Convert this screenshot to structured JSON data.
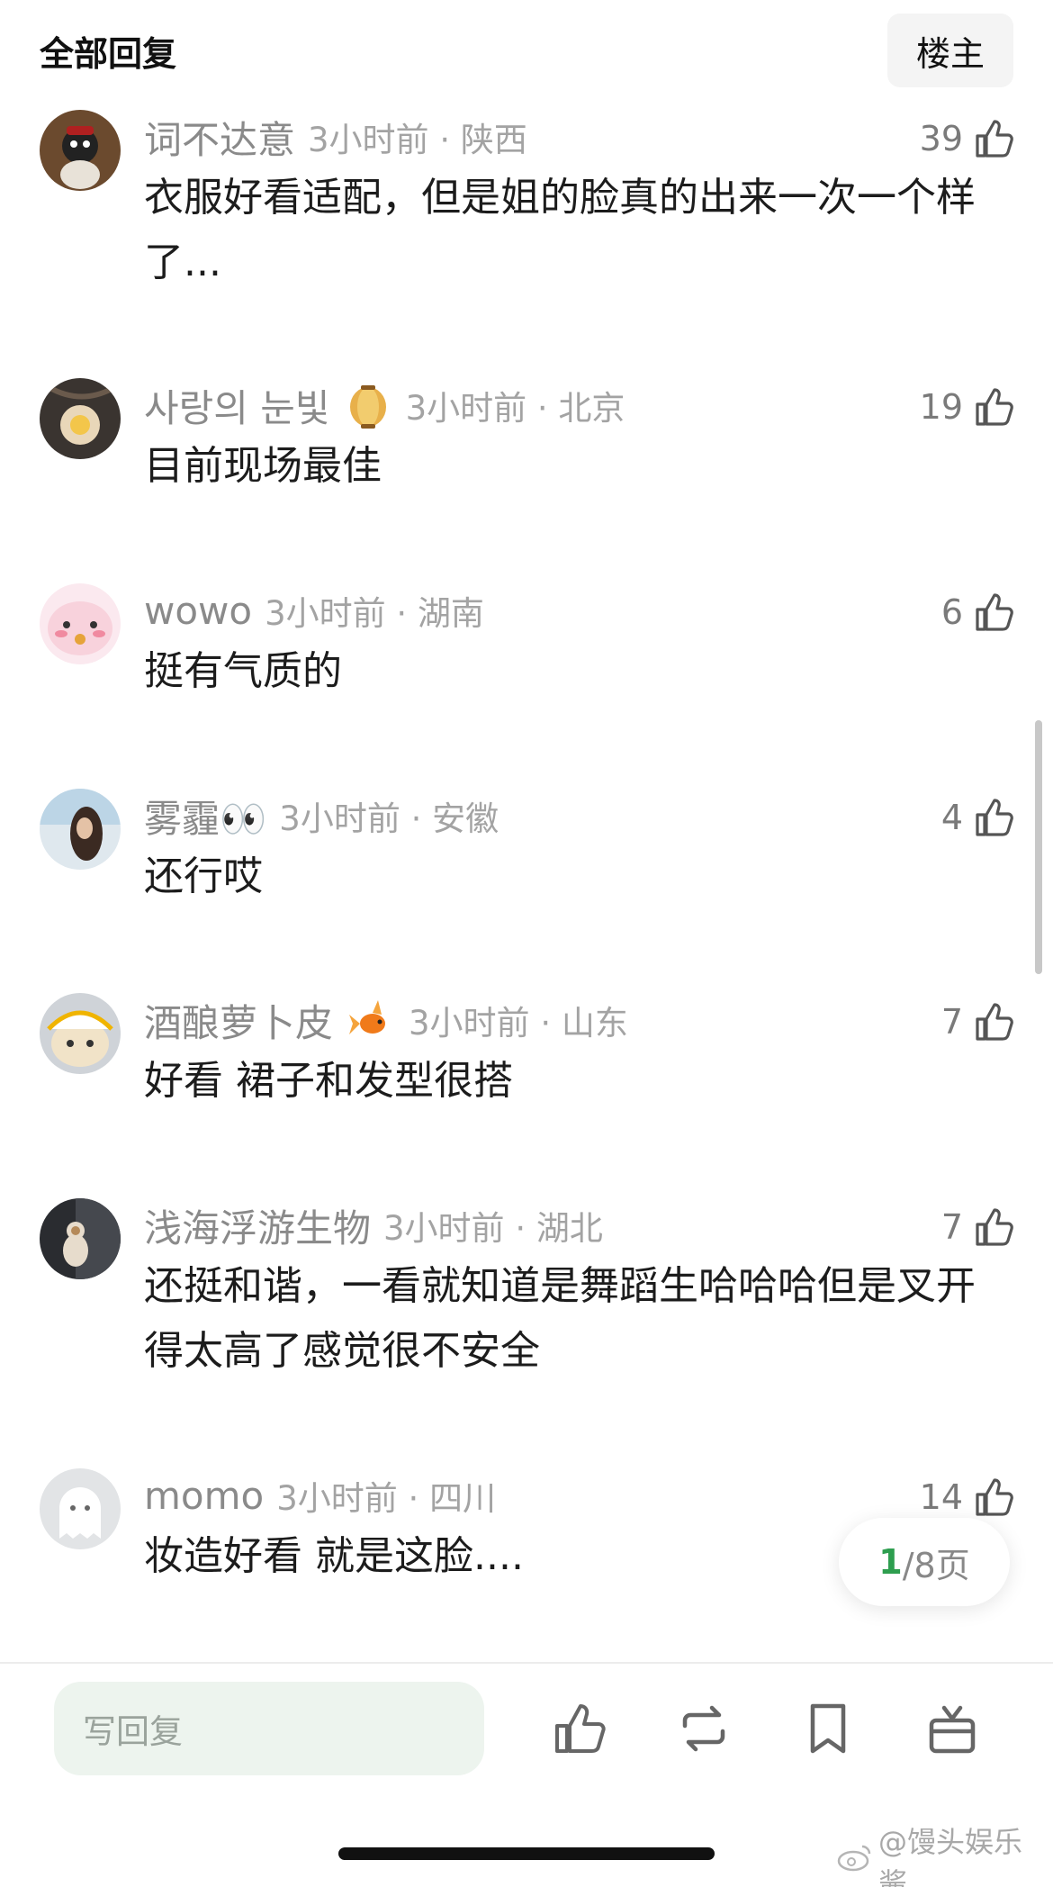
{
  "header": {
    "title": "全部回复",
    "owner_button": "楼主"
  },
  "comments": [
    {
      "username": "词不达意",
      "time": "3小时前",
      "location": "陕西",
      "likes": "39",
      "text": "衣服好看适配，但是姐的脸真的出来一次一个样了...",
      "avatar_icon": "cat-avatar-icon",
      "badge": null
    },
    {
      "username": "사랑의 눈빛",
      "time": "3小时前",
      "location": "北京",
      "likes": "19",
      "text": "目前现场最佳",
      "avatar_icon": "glowing-hand-avatar-icon",
      "badge": "lantern-badge-icon"
    },
    {
      "username": "wowo",
      "time": "3小时前",
      "location": "湖南",
      "likes": "6",
      "text": "挺有气质的",
      "avatar_icon": "pink-cartoon-avatar-icon",
      "badge": null
    },
    {
      "username": "雾霾👀",
      "time": "3小时前",
      "location": "安徽",
      "likes": "4",
      "text": "还行哎",
      "avatar_icon": "girl-photo-avatar-icon",
      "badge": null
    },
    {
      "username": "酒酿萝卜皮",
      "time": "3小时前",
      "location": "山东",
      "likes": "7",
      "text": "好看 裙子和发型很搭",
      "avatar_icon": "plush-hat-avatar-icon",
      "badge": "goldfish-badge-icon"
    },
    {
      "username": "浅海浮游生物",
      "time": "3小时前",
      "location": "湖北",
      "likes": "7",
      "text": "还挺和谐，一看就知道是舞蹈生哈哈哈但是叉开得太高了感觉很不安全",
      "avatar_icon": "cat-dark-avatar-icon",
      "badge": null
    },
    {
      "username": "momo",
      "time": "3小时前",
      "location": "四川",
      "likes": "14",
      "text": "妆造好看 就是这脸....",
      "avatar_icon": "ghost-avatar-icon",
      "badge": null
    }
  ],
  "pagination": {
    "current": "1",
    "total": "/8页"
  },
  "bottom_bar": {
    "reply_placeholder": "写回复",
    "actions": [
      "like-icon",
      "repost-icon",
      "bookmark-icon",
      "gift-icon"
    ]
  },
  "watermark": "@馒头娱乐酱",
  "colors": {
    "accent_green": "#2e9e4f",
    "reply_bg": "#edf4ee",
    "meta_gray": "#a3a3a3"
  }
}
